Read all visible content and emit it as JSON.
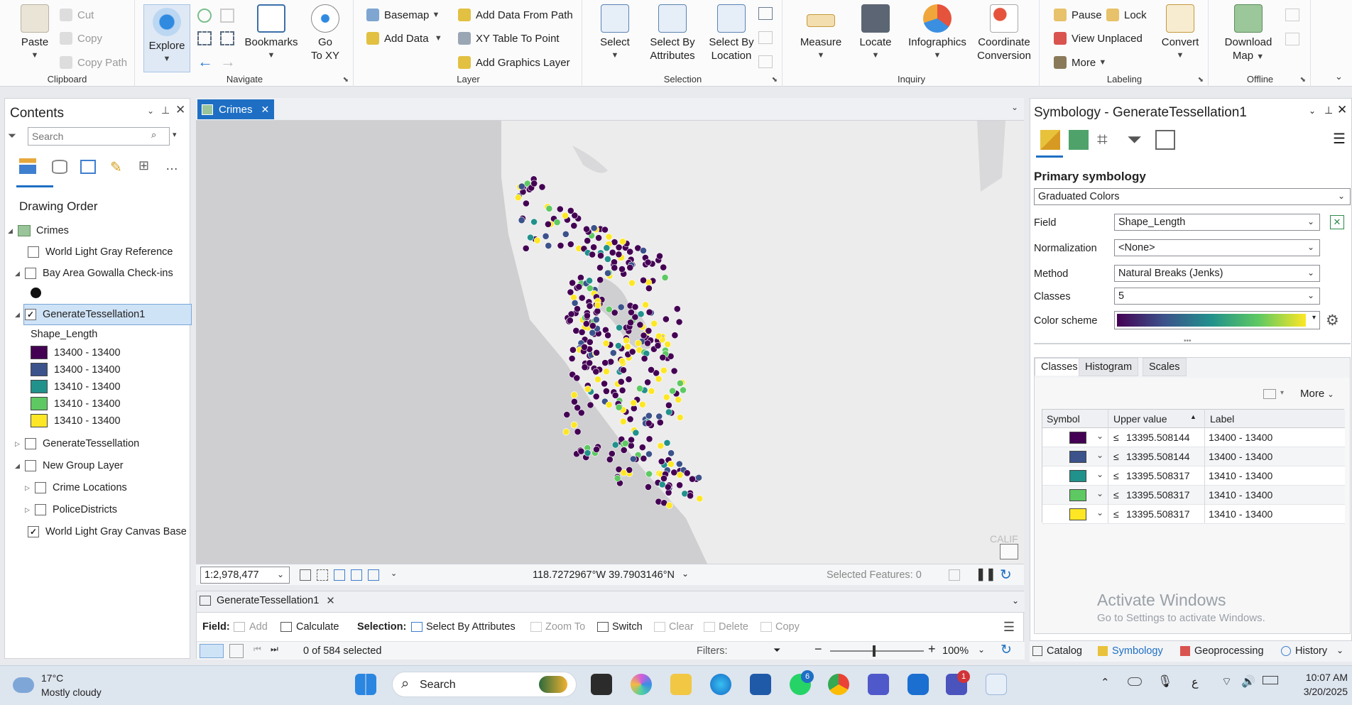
{
  "ribbon": {
    "clipboard": {
      "paste": "Paste",
      "cut": "Cut",
      "copy": "Copy",
      "copy_path": "Copy Path",
      "label": "Clipboard"
    },
    "navigate": {
      "explore": "Explore",
      "bookmarks": "Bookmarks",
      "go_to_xy_1": "Go",
      "go_to_xy_2": "To XY",
      "label": "Navigate"
    },
    "layer": {
      "basemap": "Basemap",
      "add_data": "Add Data",
      "add_data_from_path": "Add Data From Path",
      "xy_table": "XY Table To Point",
      "add_graphics": "Add Graphics Layer",
      "label": "Layer"
    },
    "selection": {
      "select": "Select",
      "select_by_attr_1": "Select By",
      "select_by_attr_2": "Attributes",
      "select_by_loc_1": "Select By",
      "select_by_loc_2": "Location",
      "label": "Selection"
    },
    "inquiry": {
      "measure": "Measure",
      "locate": "Locate",
      "infographics": "Infographics",
      "coord_1": "Coordinate",
      "coord_2": "Conversion",
      "label": "Inquiry"
    },
    "labeling": {
      "pause": "Pause",
      "lock": "Lock",
      "view_unplaced": "View Unplaced",
      "more": "More",
      "convert": "Convert",
      "label": "Labeling"
    },
    "offline": {
      "download_1": "Download",
      "download_2": "Map",
      "label": "Offline"
    }
  },
  "contents": {
    "title": "Contents",
    "search_placeholder": "Search",
    "drawing_order": "Drawing Order",
    "map_name": "Crimes",
    "layers": [
      {
        "name": "World Light Gray Reference",
        "checked": false
      },
      {
        "name": "Bay Area Gowalla Check-ins",
        "checked": false
      },
      {
        "name": "GenerateTessellation1",
        "checked": true
      },
      {
        "name": "GenerateTessellation",
        "checked": false
      },
      {
        "name": "New Group Layer",
        "checked": false
      },
      {
        "name": "Crime Locations",
        "checked": false
      },
      {
        "name": "PoliceDistricts",
        "checked": false
      },
      {
        "name": "World Light Gray Canvas Base",
        "checked": true
      }
    ],
    "legend_field": "Shape_Length",
    "legend": [
      {
        "label": "13400 - 13400",
        "color": "#440154"
      },
      {
        "label": "13400 - 13400",
        "color": "#3b528b"
      },
      {
        "label": "13410 - 13400",
        "color": "#21918c"
      },
      {
        "label": "13410 - 13400",
        "color": "#5ec962"
      },
      {
        "label": "13410 - 13400",
        "color": "#fde725"
      }
    ]
  },
  "map": {
    "tab": "Crimes",
    "scale": "1:2,978,477",
    "coordinates": "118.7272967°W 39.7903146°N",
    "selected_features": "Selected Features: 0",
    "corner_label": "CALIF"
  },
  "table": {
    "tab": "GenerateTessellation1",
    "field_label": "Field:",
    "add": "Add",
    "calculate": "Calculate",
    "selection_label": "Selection:",
    "select_by_attributes": "Select By Attributes",
    "zoom_to": "Zoom To",
    "switch": "Switch",
    "clear": "Clear",
    "delete": "Delete",
    "copy": "Copy",
    "selected_count": "0 of 584 selected",
    "filters": "Filters:",
    "zoom": "100%"
  },
  "symbology": {
    "title": "Symbology - GenerateTessellation1",
    "primary": "Primary symbology",
    "renderer": "Graduated Colors",
    "field_label": "Field",
    "field_value": "Shape_Length",
    "norm_label": "Normalization",
    "norm_value": "<None>",
    "method_label": "Method",
    "method_value": "Natural Breaks (Jenks)",
    "classes_label": "Classes",
    "classes_value": "5",
    "scheme_label": "Color scheme",
    "tabs": [
      "Classes",
      "Histogram",
      "Scales"
    ],
    "more": "More",
    "col_symbol": "Symbol",
    "col_upper": "Upper value",
    "col_label": "Label",
    "rows": [
      {
        "color": "#440154",
        "upper": "13395.508144",
        "label": "13400 - 13400"
      },
      {
        "color": "#3b528b",
        "upper": "13395.508144",
        "label": "13400 - 13400"
      },
      {
        "color": "#21918c",
        "upper": "13395.508317",
        "label": "13410 - 13400"
      },
      {
        "color": "#5ec962",
        "upper": "13395.508317",
        "label": "13410 - 13400"
      },
      {
        "color": "#fde725",
        "upper": "13395.508317",
        "label": "13410 - 13400"
      }
    ],
    "le": "≤",
    "watermark_1": "Activate Windows",
    "watermark_2": "Go to Settings to activate Windows."
  },
  "bottom_tabs": [
    "Catalog",
    "Symbology",
    "Geoprocessing",
    "History"
  ],
  "taskbar": {
    "temp": "17°C",
    "weather": "Mostly cloudy",
    "search": "Search",
    "time": "10:07 AM",
    "date": "3/20/2025",
    "lang": "ع",
    "badge_whatsapp": "6",
    "badge_teams": "1"
  },
  "colors": {
    "accent": "#1e6fc4",
    "selected_bg": "#cfe3f7"
  }
}
